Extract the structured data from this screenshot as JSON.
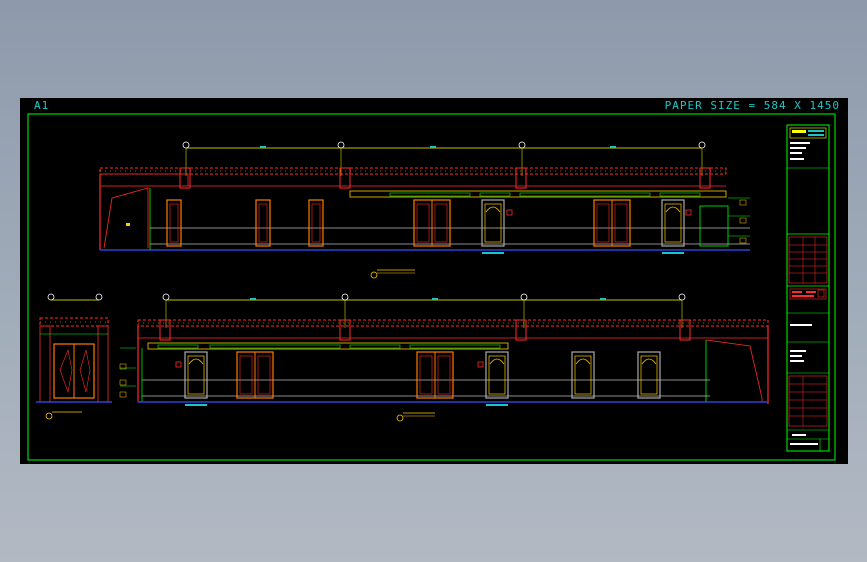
{
  "sheet": {
    "size_label": "A1",
    "paper_size": "PAPER SIZE = 584 X 1450"
  },
  "colors": {
    "background": "#000000",
    "frame": "#00ff00",
    "text": "#19c7c7",
    "wall": "#ff2a2a",
    "hatch": "#ffcc00",
    "door": "#ff7a00",
    "dim": "#ffff00",
    "floor": "#3050ff"
  },
  "icons": [
    "grid-bubble-icon",
    "section-mark-icon",
    "north-arrow-icon"
  ]
}
